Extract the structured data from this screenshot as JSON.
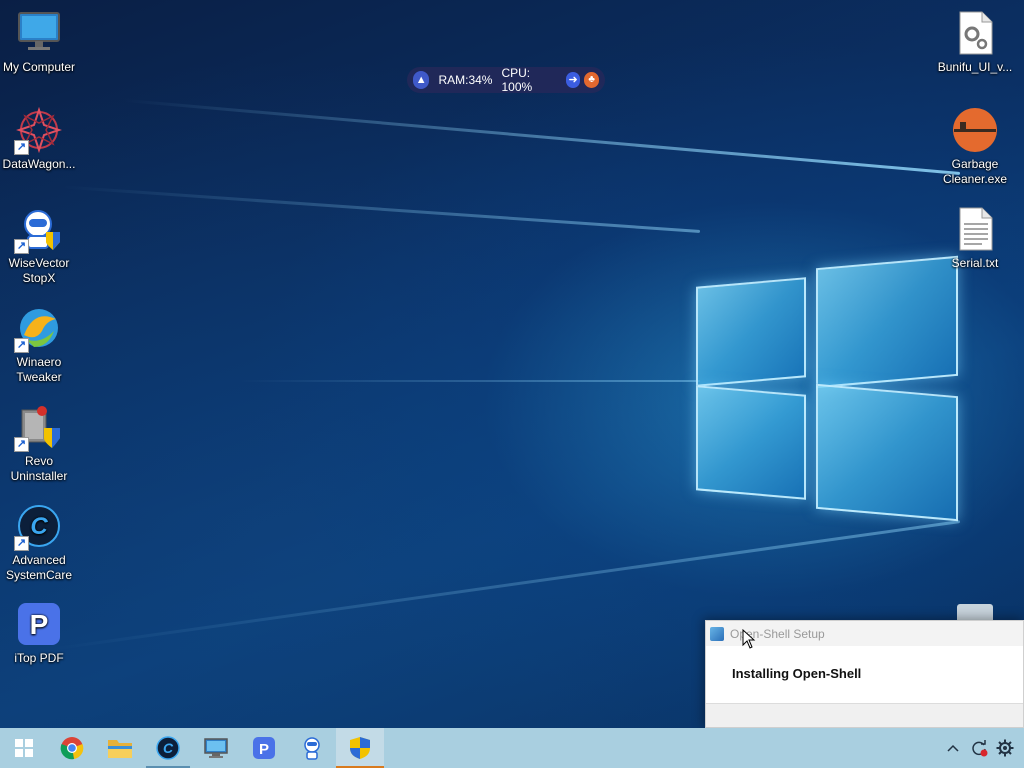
{
  "desktop": {
    "left_icons": [
      {
        "label": "My Computer",
        "icon": "monitor-icon",
        "shortcut": false
      },
      {
        "label": "DataWagon...",
        "icon": "datawagon-icon",
        "shortcut": true
      },
      {
        "label": "WiseVector StopX",
        "icon": "wisevector-icon",
        "shortcut": true
      },
      {
        "label": "Winaero Tweaker",
        "icon": "winaero-icon",
        "shortcut": true
      },
      {
        "label": "Revo Uninstaller",
        "icon": "revo-uninstaller-icon",
        "shortcut": true
      },
      {
        "label": "Advanced SystemCare",
        "icon": "advanced-systemcare-icon",
        "shortcut": true
      },
      {
        "label": "iTop PDF",
        "icon": "itop-pdf-icon",
        "shortcut": false
      }
    ],
    "right_icons": [
      {
        "label": "Bunifu_UI_v...",
        "icon": "settings-file-icon"
      },
      {
        "label": "Garbage Cleaner.exe",
        "icon": "garbage-cleaner-icon"
      },
      {
        "label": "Serial.txt",
        "icon": "text-file-icon"
      }
    ]
  },
  "perf_widget": {
    "ram": "RAM:34%",
    "cpu": "CPU: 100%"
  },
  "setup_dialog": {
    "title": "Open-Shell Setup",
    "status": "Installing Open-Shell"
  },
  "taskbar": {
    "items": [
      {
        "name": "start-button",
        "icon": "windows-logo-icon"
      },
      {
        "name": "chrome",
        "icon": "chrome-icon"
      },
      {
        "name": "file-explorer",
        "icon": "folder-icon"
      },
      {
        "name": "advanced-systemcare",
        "icon": "advanced-systemcare-icon",
        "state": "running"
      },
      {
        "name": "remote-desktop",
        "icon": "remote-desktop-icon"
      },
      {
        "name": "itop-pdf",
        "icon": "itop-pdf-icon"
      },
      {
        "name": "wisevector",
        "icon": "wisevector-icon"
      },
      {
        "name": "open-shell-setup",
        "icon": "shield-icon",
        "state": "active"
      }
    ],
    "tray": [
      "chevron-up-icon",
      "sync-icon",
      "gear-icon"
    ]
  },
  "colors": {
    "taskbar": "#a9cfe0",
    "active_indicator": "#d87a1e",
    "widget_bg": "#28285a"
  }
}
